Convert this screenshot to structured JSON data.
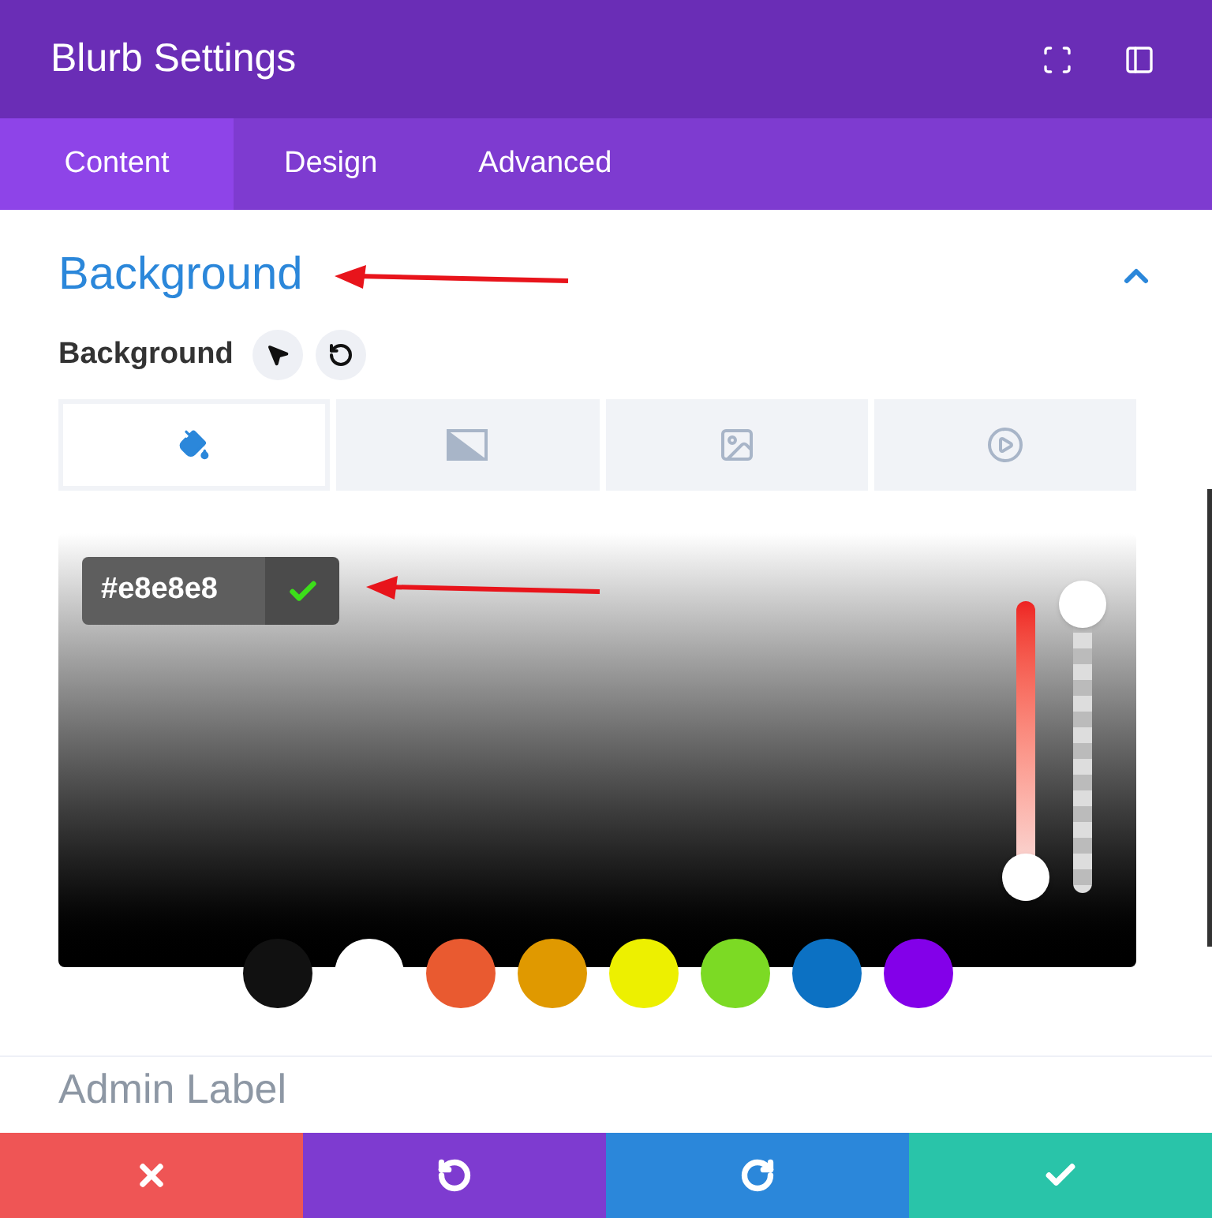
{
  "window": {
    "title": "Blurb Settings"
  },
  "tabs": [
    {
      "label": "Content",
      "selected": true
    },
    {
      "label": "Design",
      "selected": false
    },
    {
      "label": "Advanced",
      "selected": false
    }
  ],
  "section": {
    "title": "Background",
    "expanded": true
  },
  "field": {
    "label": "Background"
  },
  "background_types": [
    {
      "kind": "color",
      "selected": true
    },
    {
      "kind": "gradient",
      "selected": false
    },
    {
      "kind": "image",
      "selected": false
    },
    {
      "kind": "video",
      "selected": false
    }
  ],
  "color_picker": {
    "hex_value": "#e8e8e8",
    "hue_slider": {
      "level": 0
    },
    "opacity_slider": {
      "level": 1
    },
    "swatches": [
      {
        "color": "#111111"
      },
      {
        "color": "#ffffff"
      },
      {
        "color": "#e95a30"
      },
      {
        "color": "#e09900"
      },
      {
        "color": "#edf000"
      },
      {
        "color": "#7cda24"
      },
      {
        "color": "#0c71c3"
      },
      {
        "color": "#8300e9"
      }
    ]
  },
  "next_section": {
    "title": "Admin Label"
  },
  "footer_buttons": [
    {
      "kind": "cancel"
    },
    {
      "kind": "undo"
    },
    {
      "kind": "redo"
    },
    {
      "kind": "save"
    }
  ]
}
